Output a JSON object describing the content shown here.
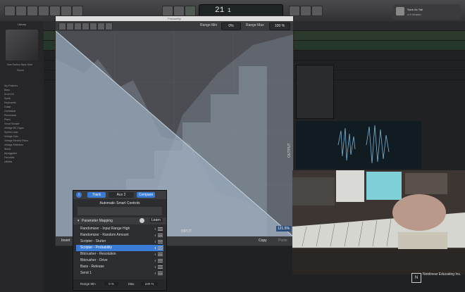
{
  "topbar": {
    "lcd_main": "21",
    "lcd_sub": "1",
    "notification": {
      "title": "Save As Tab",
      "subtitle": "4 ft Header"
    }
  },
  "library": {
    "title": "Library",
    "patch_name": "Saw Techno Bass Sme",
    "patch_sub": "Sound",
    "items": [
      "Arp Patches",
      "Bass",
      "Drum Kit",
      "Synth",
      "Keyboards",
      "Guitar",
      "Orchestral",
      "Percussion",
      "Piano",
      "Vocal Sample",
      "Vintage B3 Organ",
      "Synths Lead",
      "Vintage Clav",
      "Vintage Electric Piano",
      "Vintage Mellotron",
      "World",
      "Arpeggiator",
      "Favorites",
      "Utilities"
    ]
  },
  "plugin": {
    "window_title": "Probability",
    "range_min_label": "Range Min",
    "range_min_value": "0%",
    "range_max_label": "Range Max",
    "range_max_value": "100 %",
    "graph_axis_label": "INPUT",
    "output_label": "OUTPUT",
    "readout": "121.5%",
    "invert_label": "Invert",
    "copy_label": "Copy",
    "paste_label": "Paste"
  },
  "smart_controls": {
    "info_icon": "i",
    "track_label": "Track",
    "aux_label": "Aux 2",
    "compare_label": "Compare",
    "title": "Automatic Smart Controls",
    "mapping_label": "Parameter Mapping",
    "learn_label": "Learn",
    "rows": [
      "Randomizer - Input Range High",
      "Randomizer - Random Amount",
      "Scripter - Stutter",
      "Scripter - Probability",
      "Bitcrusher - Resolution",
      "Bitcrusher - Drive",
      "Bass - Release",
      "Send 1"
    ],
    "selected_row": 3,
    "range_min_label": "Range Min",
    "range_min_value": "0 %",
    "range_max_label": "Max",
    "range_max_value": "100 %"
  },
  "branding": {
    "mark": "N",
    "name": "Nonlinear Educating Inc."
  },
  "colors": {
    "accent_blue": "#3a7bd5",
    "graph_fill": "#8fa0b2",
    "graph_bg": "#4b4d52"
  }
}
